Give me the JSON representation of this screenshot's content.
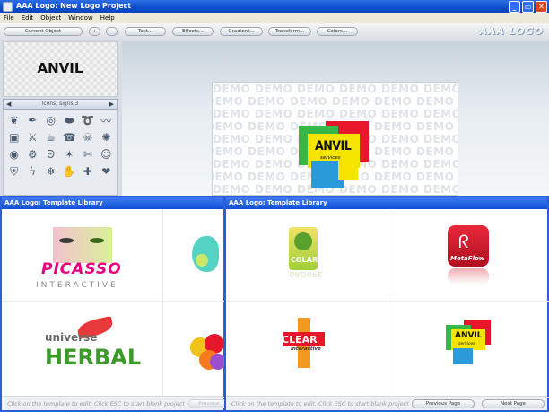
{
  "window": {
    "title": "AAA Logo: New Logo Project",
    "min_icon": "minimize-icon",
    "max_icon": "maximize-icon",
    "close_icon": "close-icon"
  },
  "menu": [
    "File",
    "Edit",
    "Object",
    "Window",
    "Help"
  ],
  "toolbar": {
    "current_object": "Current Object",
    "add": "+",
    "remove": "-",
    "text": "Text...",
    "effects": "Effects...",
    "gradient": "Gradient...",
    "transform": "Transform...",
    "colors": "Colors...",
    "brand": "AAA LOGO"
  },
  "left_panel": {
    "preview_text": "ANVIL",
    "category_label": "Icons, signs 3"
  },
  "canvas": {
    "watermark": "DEMO",
    "logo_word": "ANVIL",
    "logo_sub": "services"
  },
  "dialog_left": {
    "title": "AAA Logo: Template Library",
    "hint": "Click on the template to edit. Click ESC to start blank project",
    "prev_button": "Previous",
    "templates": [
      {
        "name": "PICASSO",
        "sub": "INTERACTIVE"
      },
      {
        "name": ""
      },
      {
        "name": "HERBAL",
        "sub": "universe"
      },
      {
        "name": ""
      }
    ]
  },
  "dialog_right": {
    "title": "AAA Logo: Template Library",
    "hint": "Click on the template to edit. Click ESC to start blank project",
    "prev_button": "Previous Page",
    "next_button": "Next Page",
    "templates": [
      {
        "name": "COLART",
        "sub": "GROUPE"
      },
      {
        "name": "MetaFlow"
      },
      {
        "name": "CLEAR",
        "sub": "interactive"
      },
      {
        "name": "ANVIL",
        "sub": "services"
      }
    ]
  },
  "colors": {
    "title_blue": "#0b4ccc",
    "dialog_border": "#2c5fd6",
    "anvil_red": "#e8162b",
    "anvil_green": "#37b64a",
    "anvil_yellow": "#f5e400",
    "anvil_blue": "#2a9bd8",
    "metaflow_red": "#d3182a",
    "picasso_pink": "#e6007e",
    "herbal_green": "#3c9a2b"
  }
}
